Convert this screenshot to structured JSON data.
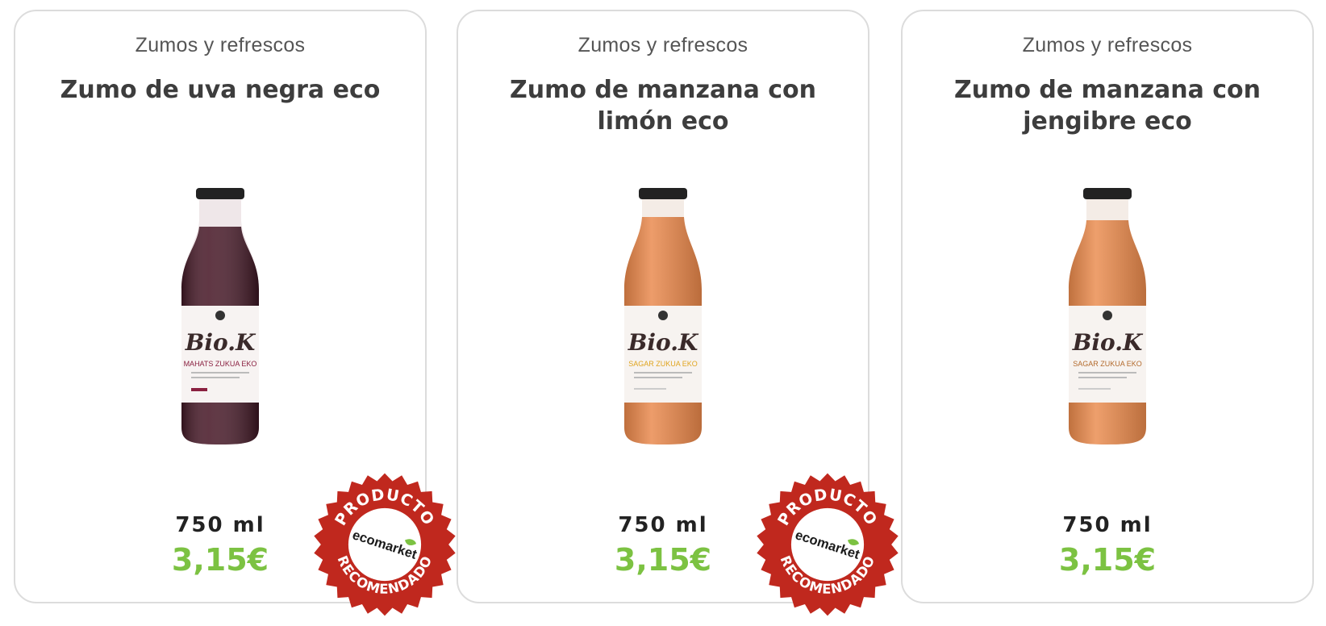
{
  "products": [
    {
      "category": "Zumos y refrescos",
      "name": "Zumo de uva negra eco",
      "volume": "750 ml",
      "price": "3,15€",
      "bottle": {
        "juice_color": "#4a1b2a",
        "brand": "Bio.K",
        "label_line": "MAHATS ZUKUA EKO",
        "accent": "#8a2040"
      }
    },
    {
      "category": "Zumos y refrescos",
      "name": "Zumo de manzana con limón eco",
      "volume": "750 ml",
      "price": "3,15€",
      "bottle": {
        "juice_color": "#e9874a",
        "brand": "Bio.K",
        "label_line": "SAGAR ZUKUA EKO",
        "accent": "#e0a51f"
      }
    },
    {
      "category": "Zumos y refrescos",
      "name": "Zumo de manzana con jengibre eco",
      "volume": "750 ml",
      "price": "3,15€",
      "bottle": {
        "juice_color": "#ea8a4c",
        "brand": "Bio.K",
        "label_line": "SAGAR ZUKUA EKO",
        "accent": "#b36a2c"
      }
    }
  ],
  "badge": {
    "top_text": "PRODUCTO",
    "bottom_text": "RECOMENDADO",
    "center_text": "ecomarket",
    "color": "#c0281e"
  },
  "colors": {
    "price": "#7cc242",
    "title": "#3d3d3d",
    "border": "#dcdcdc"
  }
}
